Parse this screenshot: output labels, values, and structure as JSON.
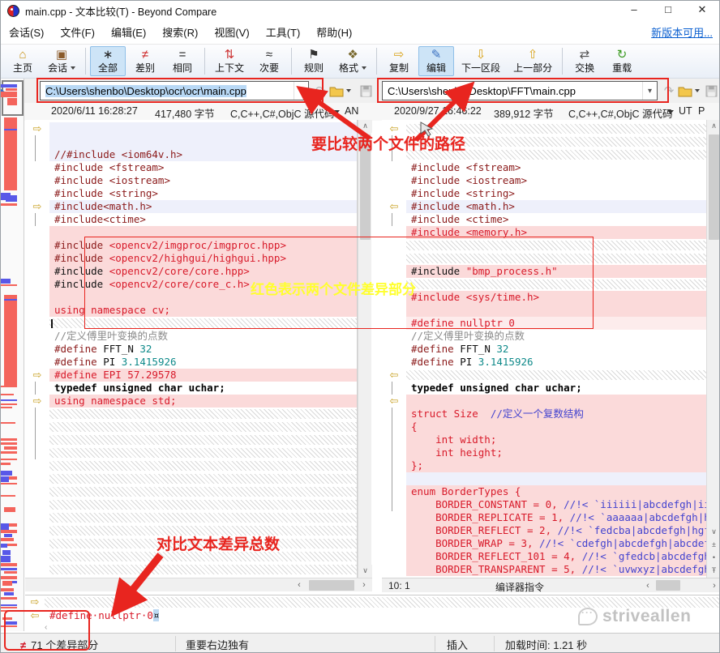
{
  "window": {
    "title": "main.cpp - 文本比较(T) - Beyond Compare",
    "minimize": "–",
    "maximize": "□",
    "close": "✕"
  },
  "menu": {
    "items": [
      "会话(S)",
      "文件(F)",
      "编辑(E)",
      "搜索(R)",
      "视图(V)",
      "工具(T)",
      "帮助(H)"
    ],
    "update_link": "新版本可用..."
  },
  "toolbar": {
    "buttons": [
      {
        "name": "home",
        "label": "主页"
      },
      {
        "name": "session",
        "label": "会话",
        "caret": true,
        "sep": true
      },
      {
        "name": "all",
        "label": "全部",
        "active": true
      },
      {
        "name": "diffs",
        "label": "差别"
      },
      {
        "name": "same",
        "label": "相同",
        "sep": true
      },
      {
        "name": "context",
        "label": "上下文"
      },
      {
        "name": "minor",
        "label": "次要",
        "sep": true
      },
      {
        "name": "rules",
        "label": "规则"
      },
      {
        "name": "format",
        "label": "格式",
        "caret": true,
        "sep": true
      },
      {
        "name": "copy",
        "label": "复制"
      },
      {
        "name": "edit",
        "label": "编辑",
        "active": true
      },
      {
        "name": "next-section",
        "label": "下一区段"
      },
      {
        "name": "prev-section",
        "label": "上一部分",
        "sep": true
      },
      {
        "name": "swap",
        "label": "交换"
      },
      {
        "name": "reload",
        "label": "重载"
      }
    ]
  },
  "left_file": {
    "path": "C:\\Users\\shenbo\\Desktop\\ocr\\ocr\\main.cpp",
    "modified": "2020/6/11 16:28:27",
    "size": "417,480 字节",
    "format": "C,C++,C#,ObjC 源代码",
    "encoding": "AN"
  },
  "right_file": {
    "path": "C:\\Users\\shenbo\\Desktop\\FFT\\main.cpp",
    "modified": "2020/9/27 16:46:22",
    "size": "389,912 字节",
    "format": "C,C++,C#,ObjC 源代码",
    "encoding": "UT",
    "flag": "P"
  },
  "left_pane": {
    "lines": [
      {
        "bg": "l",
        "m": "r"
      },
      {
        "bg": "l",
        "conn": 1
      },
      {
        "bg": "l",
        "conn": 1,
        "segs": [
          [
            "m",
            "//#include <iom64v.h>"
          ]
        ]
      },
      {
        "bg": "w",
        "segs": [
          [
            "m",
            "#include <fstream>"
          ]
        ]
      },
      {
        "bg": "w",
        "segs": [
          [
            "m",
            "#include <iostream>"
          ]
        ]
      },
      {
        "bg": "w",
        "segs": [
          [
            "m",
            "#include <string>"
          ]
        ]
      },
      {
        "bg": "l",
        "m": "r",
        "segs": [
          [
            "m",
            "#include<math.h>"
          ]
        ]
      },
      {
        "bg": "w",
        "conn": 1,
        "segs": [
          [
            "m",
            "#include<ctime>"
          ]
        ]
      },
      {
        "bg": "p"
      },
      {
        "bg": "p",
        "segs": [
          [
            "m",
            "#include "
          ],
          [
            "r",
            "<opencv2/imgproc/imgproc.hpp>"
          ]
        ]
      },
      {
        "bg": "p",
        "segs": [
          [
            "m",
            "#include "
          ],
          [
            "r",
            "<opencv2/highgui/highgui.hpp>"
          ]
        ]
      },
      {
        "bg": "p",
        "segs": [
          [
            "k",
            "#include "
          ],
          [
            "r",
            "<opencv2/core/core.hpp>"
          ]
        ]
      },
      {
        "bg": "p",
        "segs": [
          [
            "k",
            "#include "
          ],
          [
            "r",
            "<opencv2/core/core_c.h>"
          ]
        ]
      },
      {
        "bg": "p"
      },
      {
        "bg": "p",
        "segs": [
          [
            "r",
            "using namespace cv;"
          ]
        ]
      },
      {
        "bg": "h",
        "cursor": 1
      },
      {
        "bg": "w",
        "segs": [
          [
            "c",
            "//定义傅里叶变换的点数"
          ]
        ]
      },
      {
        "bg": "w",
        "segs": [
          [
            "m",
            "#define "
          ],
          [
            "k",
            "FFT_N "
          ],
          [
            "n",
            "32"
          ]
        ]
      },
      {
        "bg": "w",
        "segs": [
          [
            "m",
            "#define "
          ],
          [
            "k",
            "PI "
          ],
          [
            "n",
            "3.1415926"
          ]
        ]
      },
      {
        "bg": "p",
        "m": "r",
        "segs": [
          [
            "r",
            "#define EPI 57.29578"
          ]
        ]
      },
      {
        "bg": "w",
        "conn": 1,
        "segs": [
          [
            "bk",
            "typedef unsigned char uchar;"
          ]
        ]
      },
      {
        "bg": "p",
        "m": "r",
        "segs": [
          [
            "r",
            "using namespace std;"
          ]
        ]
      },
      {
        "bg": "h",
        "conn": 1
      },
      {
        "bg": "h",
        "conn": 1
      },
      {
        "bg": "h",
        "conn": 1
      },
      {
        "bg": "h",
        "conn": 1
      },
      {
        "bg": "h"
      },
      {
        "bg": "h"
      },
      {
        "bg": "h"
      },
      {
        "bg": "h"
      },
      {
        "bg": "h"
      },
      {
        "bg": "h"
      },
      {
        "bg": "h"
      },
      {
        "bg": "h"
      },
      {
        "bg": "h"
      }
    ]
  },
  "right_pane": {
    "lines": [
      {
        "bg": "h",
        "m": "l"
      },
      {
        "bg": "h",
        "conn": 1
      },
      {
        "bg": "h",
        "conn": 1
      },
      {
        "bg": "w",
        "segs": [
          [
            "m",
            "#include <fstream>"
          ]
        ]
      },
      {
        "bg": "w",
        "segs": [
          [
            "m",
            "#include <iostream>"
          ]
        ]
      },
      {
        "bg": "w",
        "segs": [
          [
            "m",
            "#include <string>"
          ]
        ]
      },
      {
        "bg": "l",
        "m": "l",
        "segs": [
          [
            "m",
            "#include <math.h>"
          ]
        ]
      },
      {
        "bg": "w",
        "conn": 1,
        "segs": [
          [
            "m",
            "#include <ctime>"
          ]
        ]
      },
      {
        "bg": "p",
        "segs": [
          [
            "r",
            "#include <memory.h>"
          ]
        ]
      },
      {
        "bg": "h"
      },
      {
        "bg": "h"
      },
      {
        "bg": "p",
        "segs": [
          [
            "k",
            "#include "
          ],
          [
            "r",
            "\"bmp_process.h\""
          ]
        ]
      },
      {
        "bg": "h"
      },
      {
        "bg": "p",
        "segs": [
          [
            "r",
            "#include <sys/time.h>"
          ]
        ]
      },
      {
        "bg": "p"
      },
      {
        "bg": "pl",
        "segs": [
          [
            "r",
            "#define nullptr 0"
          ]
        ]
      },
      {
        "bg": "w",
        "segs": [
          [
            "c",
            "//定义傅里叶变换的点数"
          ]
        ]
      },
      {
        "bg": "w",
        "segs": [
          [
            "m",
            "#define "
          ],
          [
            "k",
            "FFT_N "
          ],
          [
            "n",
            "32"
          ]
        ]
      },
      {
        "bg": "w",
        "segs": [
          [
            "m",
            "#define "
          ],
          [
            "k",
            "PI "
          ],
          [
            "n",
            "3.1415926"
          ]
        ]
      },
      {
        "bg": "h",
        "m": "l"
      },
      {
        "bg": "w",
        "conn": 1,
        "segs": [
          [
            "bk",
            "typedef unsigned char uchar;"
          ]
        ]
      },
      {
        "bg": "p",
        "m": "l"
      },
      {
        "bg": "p",
        "conn": 1,
        "segs": [
          [
            "r",
            "struct Size  "
          ],
          [
            "b",
            "//定义一个复数结构"
          ]
        ]
      },
      {
        "bg": "p",
        "conn": 1,
        "segs": [
          [
            "r",
            "{"
          ]
        ]
      },
      {
        "bg": "p",
        "conn": 1,
        "segs": [
          [
            "r",
            "    int width;"
          ]
        ]
      },
      {
        "bg": "p",
        "conn": 1,
        "segs": [
          [
            "r",
            "    int height;"
          ]
        ]
      },
      {
        "bg": "p",
        "conn": 1,
        "segs": [
          [
            "r",
            "};"
          ]
        ]
      },
      {
        "bg": "l",
        "conn": 1
      },
      {
        "bg": "p",
        "conn": 1,
        "segs": [
          [
            "r",
            "enum BorderTypes {"
          ]
        ]
      },
      {
        "bg": "p",
        "conn": 1,
        "segs": [
          [
            "r",
            "    BORDER_CONSTANT = 0, "
          ],
          [
            "b",
            "//!< `iiiiii|abcdefgh|iiiii"
          ]
        ]
      },
      {
        "bg": "p",
        "segs": [
          [
            "r",
            "    BORDER_REPLICATE = 1, "
          ],
          [
            "b",
            "//!< `aaaaaa|abcdefgh|hhhh"
          ]
        ]
      },
      {
        "bg": "p",
        "segs": [
          [
            "r",
            "    BORDER_REFLECT = 2, "
          ],
          [
            "b",
            "//!< `fedcba|abcdefgh|hgfedc"
          ]
        ]
      },
      {
        "bg": "p",
        "segs": [
          [
            "r",
            "    BORDER_WRAP = 3, "
          ],
          [
            "b",
            "//!< `cdefgh|abcdefgh|abcdefg`"
          ]
        ]
      },
      {
        "bg": "p",
        "segs": [
          [
            "r",
            "    BORDER_REFLECT_101 = 4, "
          ],
          [
            "b",
            "//!< `gfedcb|abcdefgh|gf"
          ]
        ]
      },
      {
        "bg": "p",
        "segs": [
          [
            "r",
            "    BORDER_TRANSPARENT = 5, "
          ],
          [
            "b",
            "//!< `uvwxyz|abcdefgh|ij"
          ]
        ]
      }
    ]
  },
  "right_status": {
    "position": "10: 1",
    "context": "编译器指令"
  },
  "detail_pane": {
    "rows": [
      {
        "bg": "h",
        "m": "r"
      },
      {
        "bg": "w",
        "m": "l",
        "segs": [
          [
            "r",
            "#define·nullptr·0"
          ],
          [
            "sel",
            "¤"
          ]
        ]
      }
    ]
  },
  "status_bar": {
    "diff_icon": "≠",
    "diff_count": "71 个差异部分",
    "importance": "重要右边独有",
    "mode": "插入",
    "load_time": "加载时间: 1.21 秒"
  },
  "annotations": {
    "path_label": "要比较两个文件的路径",
    "diff_label": "红色表示两个文件差异部分",
    "count_label": "对比文本差异总数",
    "color": "#e8251f"
  },
  "watermark": {
    "text": "striveallen"
  },
  "diff_map": {
    "bars": [
      {
        "t": 7,
        "h": 4,
        "c": "b",
        "l": 8,
        "w": 20
      },
      {
        "t": 12,
        "h": 3,
        "c": "r",
        "l": 14,
        "w": 14
      },
      {
        "t": 16,
        "h": 7,
        "c": "r",
        "l": 8,
        "w": 20
      },
      {
        "t": 24,
        "h": 9,
        "c": "r",
        "l": 16,
        "w": 12
      },
      {
        "t": 48,
        "h": 90,
        "c": "r",
        "l": 12,
        "w": 16
      },
      {
        "t": 62,
        "h": 2,
        "c": "b",
        "l": 12,
        "w": 16
      },
      {
        "t": 141,
        "h": 9,
        "c": "b",
        "l": 8,
        "w": 12
      },
      {
        "t": 144,
        "h": 8,
        "c": "b",
        "l": 14,
        "w": 14
      },
      {
        "t": 154,
        "h": 3,
        "c": "r",
        "l": 8,
        "w": 20
      },
      {
        "t": 247,
        "h": 6,
        "c": "b",
        "l": 8,
        "w": 12
      },
      {
        "t": 254,
        "h": 2,
        "c": "r",
        "l": 8,
        "w": 20
      },
      {
        "t": 267,
        "h": 113,
        "c": "r",
        "l": 12,
        "w": 16
      },
      {
        "t": 272,
        "h": 2,
        "c": "b",
        "l": 12,
        "w": 16
      },
      {
        "t": 379,
        "h": 2,
        "c": "r",
        "l": 8,
        "w": 20
      },
      {
        "t": 389,
        "h": 2,
        "c": "r",
        "l": 8,
        "w": 16
      },
      {
        "t": 396,
        "h": 2,
        "c": "b",
        "l": 8,
        "w": 20
      },
      {
        "t": 401,
        "h": 2,
        "c": "r",
        "l": 8,
        "w": 20
      },
      {
        "t": 405,
        "h": 2,
        "c": "r",
        "l": 8,
        "w": 14
      },
      {
        "t": 424,
        "h": 2,
        "c": "r",
        "l": 8,
        "w": 18
      },
      {
        "t": 444,
        "h": 3,
        "c": "r",
        "l": 8,
        "w": 20
      },
      {
        "t": 449,
        "h": 3,
        "c": "r",
        "l": 8,
        "w": 20
      },
      {
        "t": 454,
        "h": 4,
        "c": "r",
        "l": 12,
        "w": 16
      },
      {
        "t": 460,
        "h": 3,
        "c": "r",
        "l": 8,
        "w": 20
      },
      {
        "t": 469,
        "h": 2,
        "c": "r",
        "l": 8,
        "w": 20
      },
      {
        "t": 474,
        "h": 3,
        "c": "r",
        "l": 8,
        "w": 12
      },
      {
        "t": 484,
        "h": 6,
        "c": "b",
        "l": 8,
        "w": 14
      },
      {
        "t": 491,
        "h": 7,
        "c": "b",
        "l": 8,
        "w": 10
      },
      {
        "t": 491,
        "h": 4,
        "c": "r",
        "l": 18,
        "w": 10
      },
      {
        "t": 499,
        "h": 2,
        "c": "r",
        "l": 8,
        "w": 20
      },
      {
        "t": 514,
        "h": 2,
        "c": "r",
        "l": 8,
        "w": 18
      },
      {
        "t": 529,
        "h": 6,
        "c": "r",
        "l": 12,
        "w": 14
      },
      {
        "t": 549,
        "h": 8,
        "c": "b",
        "l": 8,
        "w": 10
      },
      {
        "t": 549,
        "h": 4,
        "c": "r",
        "l": 18,
        "w": 10
      },
      {
        "t": 557,
        "h": 4,
        "c": "r",
        "l": 8,
        "w": 20
      },
      {
        "t": 562,
        "h": 4,
        "c": "b",
        "l": 12,
        "w": 10
      },
      {
        "t": 567,
        "h": 4,
        "c": "r",
        "l": 8,
        "w": 16
      },
      {
        "t": 574,
        "h": 5,
        "c": "b",
        "l": 8,
        "w": 8
      },
      {
        "t": 574,
        "h": 3,
        "c": "r",
        "l": 16,
        "w": 12
      },
      {
        "t": 582,
        "h": 6,
        "c": "b",
        "l": 10,
        "w": 10
      },
      {
        "t": 589,
        "h": 8,
        "c": "b",
        "l": 8,
        "w": 12
      },
      {
        "t": 598,
        "h": 4,
        "c": "r",
        "l": 8,
        "w": 20
      },
      {
        "t": 604,
        "h": 3,
        "c": "b",
        "l": 8,
        "w": 20
      },
      {
        "t": 608,
        "h": 3,
        "c": "r",
        "l": 12,
        "w": 16
      },
      {
        "t": 614,
        "h": 4,
        "c": "r",
        "l": 8,
        "w": 20
      },
      {
        "t": 620,
        "h": 6,
        "c": "r",
        "l": 10,
        "w": 12
      },
      {
        "t": 620,
        "h": 3,
        "c": "b",
        "l": 22,
        "w": 6
      },
      {
        "t": 629,
        "h": 4,
        "c": "r",
        "l": 8,
        "w": 16
      },
      {
        "t": 634,
        "h": 4,
        "c": "b",
        "l": 12,
        "w": 12
      },
      {
        "t": 640,
        "h": 3,
        "c": "r",
        "l": 8,
        "w": 20
      },
      {
        "t": 649,
        "h": 2,
        "c": "b",
        "l": 8,
        "w": 20
      },
      {
        "t": 652,
        "h": 2,
        "c": "r",
        "l": 8,
        "w": 20
      },
      {
        "t": 656,
        "h": 2,
        "c": "r",
        "l": 8,
        "w": 16
      },
      {
        "t": 665,
        "h": 3,
        "c": "r",
        "l": 10,
        "w": 12
      },
      {
        "t": 670,
        "h": 4,
        "c": "b",
        "l": 14,
        "w": 14
      },
      {
        "t": 675,
        "h": 2,
        "c": "r",
        "l": 8,
        "w": 20
      }
    ]
  }
}
